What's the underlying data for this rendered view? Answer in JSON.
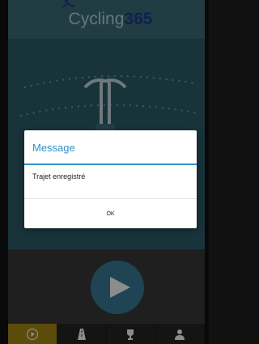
{
  "header": {
    "logo_text": "Cycling",
    "logo_number": "365"
  },
  "dialog": {
    "title": "Message",
    "message": "Trajet enregistré",
    "ok_label": "OK"
  },
  "tabs": [
    {
      "icon": "play-icon",
      "active": true
    },
    {
      "icon": "road-icon",
      "active": false
    },
    {
      "icon": "trophy-icon",
      "active": false
    },
    {
      "icon": "user-icon",
      "active": false
    }
  ],
  "colors": {
    "header": "#3f6e7c",
    "main_background": "#2f5d6b",
    "accent_blue": "#2f95c6",
    "play_button": "#3a7d97",
    "active_tab": "#a68a17"
  }
}
